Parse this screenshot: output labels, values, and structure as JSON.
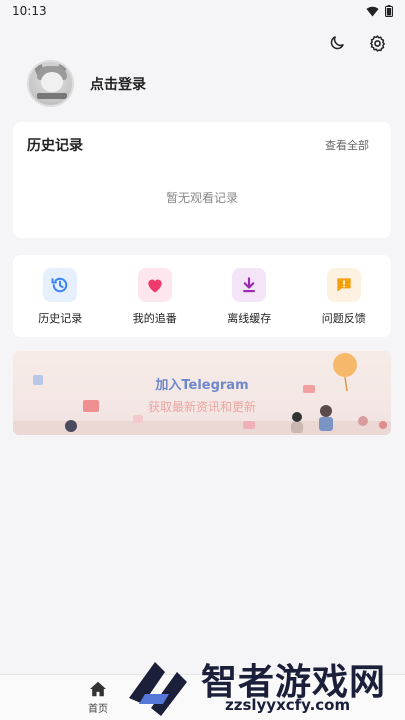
{
  "status_bar": {
    "time": "10:13",
    "wifi_icon": "wifi-icon",
    "battery_icon": "battery-icon"
  },
  "header": {
    "theme_icon": "moon-icon",
    "settings_icon": "gear-icon"
  },
  "profile": {
    "login_label": "点击登录"
  },
  "history": {
    "title": "历史记录",
    "view_all": "查看全部",
    "empty": "暂无观看记录"
  },
  "quick_actions": [
    {
      "label": "历史记录",
      "icon": "history-icon",
      "color": "#3b82f6",
      "bg": "#e6f0fd"
    },
    {
      "label": "我的追番",
      "icon": "heart-icon",
      "color": "#ef3a6e",
      "bg": "#fde6ee"
    },
    {
      "label": "离线缓存",
      "icon": "download-icon",
      "color": "#9c27b0",
      "bg": "#f3e5f7"
    },
    {
      "label": "问题反馈",
      "icon": "feedback-icon",
      "color": "#f59e0b",
      "bg": "#fdf1e1"
    }
  ],
  "banner": {
    "title": "加入Telegram",
    "subtitle": "获取最新资讯和更新"
  },
  "bottom_nav": {
    "home_label": "首页"
  },
  "watermark": {
    "name": "智者游戏网",
    "url": "zzslyyxcfy.com"
  }
}
